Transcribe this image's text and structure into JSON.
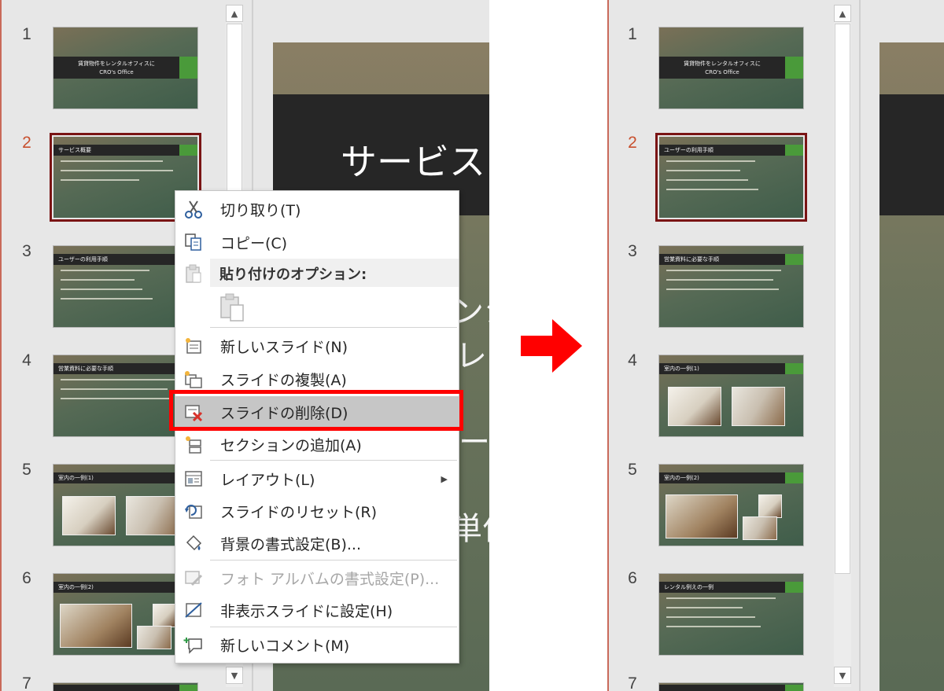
{
  "colors": {
    "accent_red": "#ff0000",
    "selected_border": "#7a1414",
    "active_number": "#c8502e",
    "slide_green": "#4a9a3a"
  },
  "left": {
    "thumb_numbers": [
      "1",
      "2",
      "3",
      "4",
      "5",
      "6",
      "7"
    ],
    "thumbs": [
      {
        "title": "賃貸物件をレンタルオフィスに",
        "subtitle": "CRO's Office"
      },
      {
        "title": "サービス概要"
      },
      {
        "title": "ユーザーの利用手順"
      },
      {
        "title": "営業資料に必要な手順"
      },
      {
        "title": "室内の一例(1)"
      },
      {
        "title": "室内の一例(2)"
      }
    ],
    "main_slide": {
      "title": "サービス",
      "line1": "ンシ",
      "line2": "レオ",
      "line3": "ーケ",
      "line4": "単位"
    }
  },
  "context_menu": {
    "items": [
      {
        "label": "切り取り(T)",
        "icon": "scissors-icon"
      },
      {
        "label": "コピー(C)",
        "icon": "copy-icon"
      },
      {
        "label": "新しいスライド(N)",
        "icon": "new-slide-icon"
      },
      {
        "label": "スライドの複製(A)",
        "icon": "duplicate-slide-icon"
      },
      {
        "label": "スライドの削除(D)",
        "icon": "delete-slide-icon"
      },
      {
        "label": "セクションの追加(A)",
        "icon": "add-section-icon"
      },
      {
        "label": "レイアウト(L)",
        "icon": "layout-icon"
      },
      {
        "label": "スライドのリセット(R)",
        "icon": "reset-slide-icon"
      },
      {
        "label": "背景の書式設定(B)...",
        "icon": "format-background-icon"
      },
      {
        "label": "フォト アルバムの書式設定(P)...",
        "icon": "photo-album-icon"
      },
      {
        "label": "非表示スライドに設定(H)",
        "icon": "hide-slide-icon"
      },
      {
        "label": "新しいコメント(M)",
        "icon": "new-comment-icon"
      }
    ],
    "paste_options_label": "貼り付けのオプション:"
  },
  "right": {
    "thumb_numbers": [
      "1",
      "2",
      "3",
      "4",
      "5",
      "6",
      "7"
    ],
    "thumbs": [
      {
        "title": "賃貸物件をレンタルオフィスに",
        "subtitle": "CRO's Office"
      },
      {
        "title": "ユーザーの利用手順"
      },
      {
        "title": "営業資料に必要な手順"
      },
      {
        "title": "室内の一例(1)"
      },
      {
        "title": "室内の一例(2)"
      },
      {
        "title": "レンタル例えの一例"
      }
    ]
  }
}
